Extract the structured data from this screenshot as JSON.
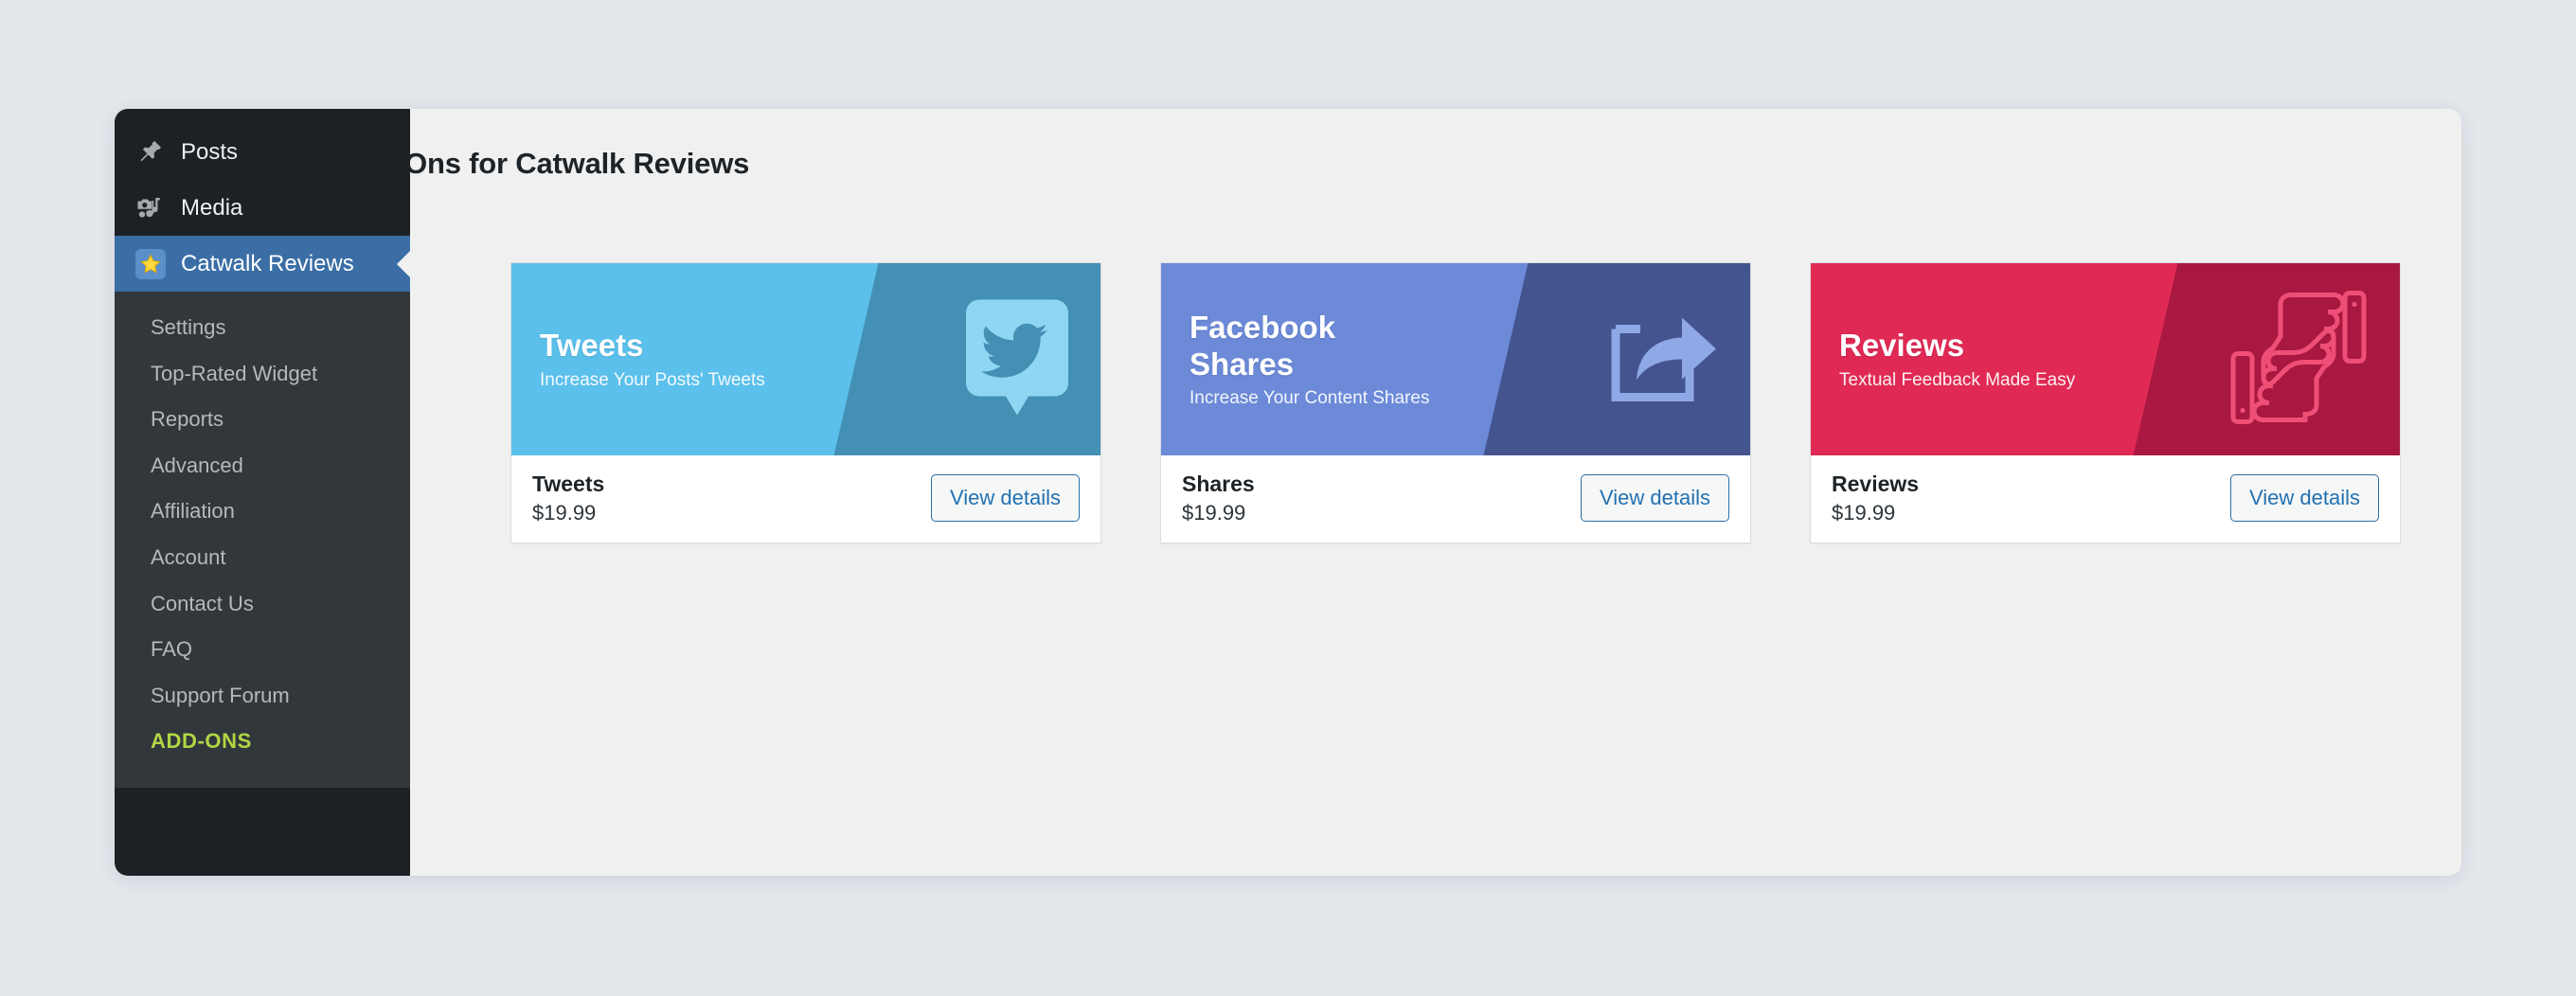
{
  "header": {
    "page_title": "Add Ons for Catwalk Reviews"
  },
  "sidebar": {
    "top_items": [
      {
        "label": "Posts",
        "icon": "pin-icon"
      },
      {
        "label": "Media",
        "icon": "camera-music-icon"
      }
    ],
    "active_item": {
      "label": "Catwalk Reviews",
      "icon": "star-icon"
    },
    "submenu": [
      {
        "label": "Settings"
      },
      {
        "label": "Top-Rated Widget"
      },
      {
        "label": "Reports"
      },
      {
        "label": "Advanced"
      },
      {
        "label": "Affiliation"
      },
      {
        "label": "Account"
      },
      {
        "label": "Contact Us"
      },
      {
        "label": "FAQ"
      },
      {
        "label": "Support Forum"
      },
      {
        "label": "ADD-ONS"
      }
    ],
    "colors": {
      "background": "#1d2126",
      "submenu_background": "#32373c",
      "active": "#3a6ea5",
      "addons_text": "#b0d644"
    }
  },
  "addons": [
    {
      "banner_title_line1": "Tweets",
      "banner_title_line2": "",
      "banner_subtitle": "Increase Your Posts' Tweets",
      "name": "Tweets",
      "price": "$19.99",
      "button_label": "View details",
      "icon": "twitter-bird-icon",
      "color": "#5bc0eb",
      "color_dark": "#4490b4"
    },
    {
      "banner_title_line1": "Facebook",
      "banner_title_line2": "Shares",
      "banner_subtitle": "Increase Your Content Shares",
      "name": "Shares",
      "price": "$19.99",
      "button_label": "View details",
      "icon": "share-arrow-icon",
      "color": "#6c8ad8",
      "color_dark": "#43548f"
    },
    {
      "banner_title_line1": "Reviews",
      "banner_title_line2": "",
      "banner_subtitle": "Textual Feedback Made Easy",
      "name": "Reviews",
      "price": "$19.99",
      "button_label": "View details",
      "icon": "thumbs-up-down-icon",
      "color": "#e02a55",
      "color_dark": "#a81840"
    }
  ]
}
